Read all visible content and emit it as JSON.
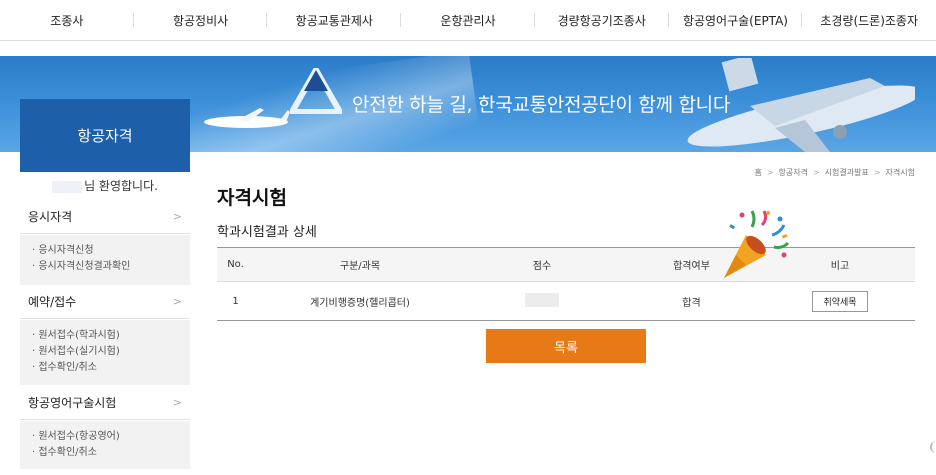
{
  "topnav": {
    "items": [
      "조종사",
      "항공정비사",
      "항공교통관제사",
      "운항관리사",
      "경량항공기조종사",
      "항공영어구술(EPTA)",
      "초경량(드론)조종자"
    ]
  },
  "banner": {
    "slogan": "안전한 하늘 길, 한국교통안전공단이 함께 합니다"
  },
  "sidebar": {
    "title": "항공자격",
    "welcome": "님 환영합니다.",
    "categories": [
      {
        "label": "응시자격",
        "items": [
          "· 응시자격신청",
          "· 응시자격신청결과확인"
        ]
      },
      {
        "label": "예약/접수",
        "items": [
          "· 원서접수(학과시험)",
          "· 원서접수(실기시험)",
          "· 접수확인/취소"
        ]
      },
      {
        "label": "항공영어구술시험",
        "items": [
          "· 원서접수(항공영어)",
          "· 접수확인/취소"
        ]
      }
    ]
  },
  "breadcrumb": [
    "홈",
    "항공자격",
    "시험결과발표",
    "자격시험"
  ],
  "page": {
    "title": "자격시험",
    "subtitle": "학과시험결과 상세"
  },
  "table": {
    "headers": [
      "No.",
      "구분/과목",
      "점수",
      "합격여부",
      "비고"
    ],
    "rows": [
      {
        "no": "1",
        "subject": "계기비행증명(헬리콥터)",
        "result": "합격",
        "action": "취약세목"
      }
    ]
  },
  "buttons": {
    "list": "목록"
  },
  "colors": {
    "sidebar_header": "#1d5fa8",
    "list_button": "#e77a16",
    "banner_blue": "#3a8ed8"
  }
}
